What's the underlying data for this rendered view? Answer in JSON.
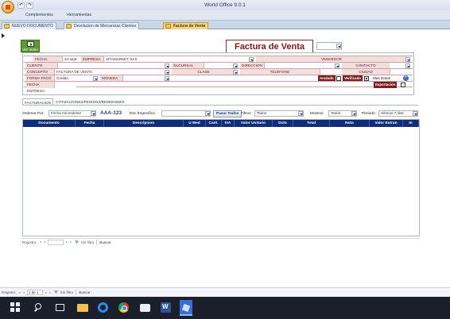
{
  "window": {
    "title": "World Office 9.0.1"
  },
  "ribbon": {
    "tabs": [
      "Complementos",
      "Herramientas"
    ]
  },
  "doc_tabs": [
    {
      "label": "NUEVO DOCUMENTO"
    },
    {
      "label": "Devolucion de Mercancias Clientes"
    },
    {
      "label": "Factura de Venta"
    }
  ],
  "toolbar": {
    "view_label": "Ver Video"
  },
  "invoice": {
    "title": "Factura de Venta",
    "fecha_label": "FECHA",
    "fecha_value": "14-sept-18",
    "empresa_label": "EMPRESA",
    "empresa_value": "VITAMARKET SAS",
    "vendedor_label": "VENDEDOR",
    "cliente_label": "CLIENTE",
    "sucursal_label": "SUCURSAL",
    "direccion_label": "DIRECCION",
    "contacto_label": "CONTACTO",
    "concepto_label": "CONCEPTO",
    "concepto_value": "FACTURA DE VENTA",
    "clase_label": "CLASE",
    "telefono_label": "TELEFONO",
    "ciudad_label": "CIUDAD",
    "forma_pago_label": "FORMA PAGO",
    "forma_pago_value": "Credito",
    "moneda_label": "MONEDA",
    "fecha_entrega_label": "FECHA ENTREGA",
    "anulado_label": "Anulado",
    "verificado_label": "Verificado",
    "mas_datos_label": "Mas Datos",
    "exportacion_label": "Exportación"
  },
  "sub_tabs": [
    "FACTURACION",
    "COTIZACIONES/PEDIDOS/REMISIONES"
  ],
  "filters": {
    "ordenar_label": "Ordenar Por:",
    "ordenar_value": "Fecha Ascendente",
    "code": "AAA-123",
    "doc_especifico_label": "Doc Especifico",
    "pasar_todos_label": "Pasar Todos",
    "filtrar_label": "Filtrar:",
    "filtrar_value": "Todos",
    "mostrar_label": "Mostrar:",
    "mostrar_value": "Todos",
    "periodo_label": "Periodo:",
    "periodo_value": "Ultimos 7 dias"
  },
  "grid": {
    "columns": [
      "Documento",
      "Fecha",
      "Descripcion",
      "U Med",
      "Cant.",
      "IVA",
      "Valor Unitario",
      "Dcto",
      "Total",
      "Nota",
      "Valor Extran",
      "In"
    ]
  },
  "nav_inner": {
    "registro_label": "Registro:",
    "filter_label": "Sin filtro",
    "search_label": "Buscar"
  },
  "nav_outer": {
    "registro_label": "Registro:",
    "position": "1 de 1",
    "filter_label": "Sin filtro",
    "search_label": "Buscar"
  },
  "colors": {
    "title_red": "#8b1414",
    "grid_header": "#0f2d78",
    "active_tab": "#f7d67f",
    "video_green": "#5e9b2e"
  }
}
